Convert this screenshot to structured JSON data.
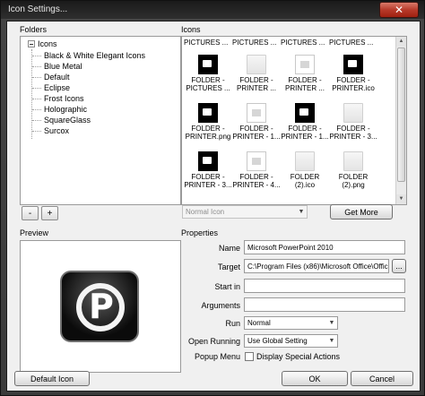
{
  "window": {
    "title": "Icon Settings..."
  },
  "folders": {
    "heading": "Folders",
    "root": "Icons",
    "items": [
      "Black & White Elegant Icons",
      "Blue Metal",
      "Default",
      "Eclipse",
      "Frost Icons",
      "Holographic",
      "SquareGlass",
      "Surcox"
    ],
    "remove_label": "-",
    "add_label": "+"
  },
  "icons": {
    "heading": "Icons",
    "top_row": [
      "PICTURES ...",
      "PICTURES ...",
      "PICTURES ...",
      "PICTURES ..."
    ],
    "cells": [
      {
        "label": "FOLDER - PICTURES ...",
        "style": "dark"
      },
      {
        "label": "FOLDER - PRINTER ...",
        "style": "folder"
      },
      {
        "label": "FOLDER - PRINTER ...",
        "style": "light"
      },
      {
        "label": "FOLDER - PRINTER.ico",
        "style": "dark"
      },
      {
        "label": "FOLDER - PRINTER.png",
        "style": "dark"
      },
      {
        "label": "FOLDER - PRINTER - 1...",
        "style": "light"
      },
      {
        "label": "FOLDER - PRINTER - 1...",
        "style": "dark"
      },
      {
        "label": "FOLDER - PRINTER - 3...",
        "style": "folder"
      },
      {
        "label": "FOLDER - PRINTER - 3...",
        "style": "dark"
      },
      {
        "label": "FOLDER - PRINTER - 4...",
        "style": "light"
      },
      {
        "label": "FOLDER (2).ico",
        "style": "folder"
      },
      {
        "label": "FOLDER (2).png",
        "style": "folder"
      }
    ],
    "type_select": "Normal Icon",
    "get_more_label": "Get More"
  },
  "preview": {
    "heading": "Preview"
  },
  "properties": {
    "heading": "Properties",
    "name_label": "Name",
    "name_value": "Microsoft PowerPoint 2010",
    "target_label": "Target",
    "target_value": "C:\\Program Files (x86)\\Microsoft Office\\Offic",
    "browse_label": "...",
    "start_in_label": "Start in",
    "start_in_value": "",
    "arguments_label": "Arguments",
    "arguments_value": "",
    "run_label": "Run",
    "run_value": "Normal",
    "open_running_label": "Open Running",
    "open_running_value": "Use Global Setting",
    "popup_label": "Popup Menu",
    "popup_checkbox_label": "Display Special Actions"
  },
  "footer": {
    "default_icon_label": "Default Icon",
    "ok_label": "OK",
    "cancel_label": "Cancel"
  }
}
